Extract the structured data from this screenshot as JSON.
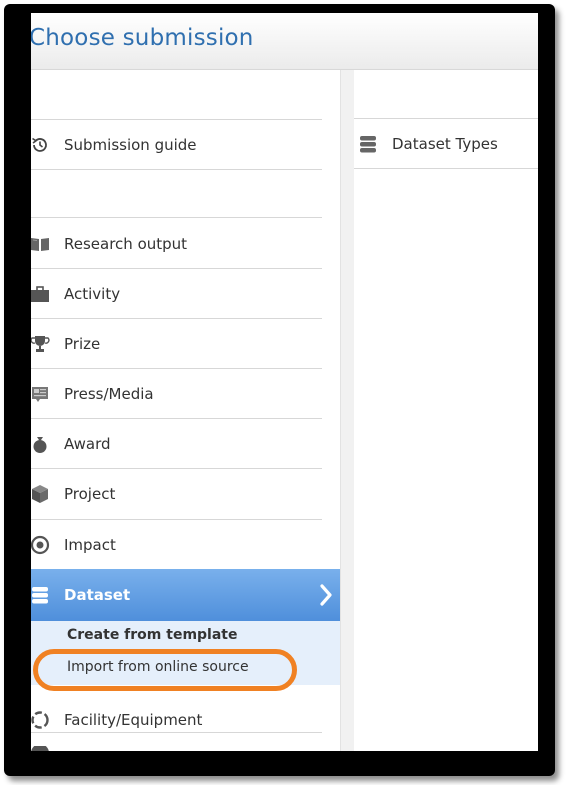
{
  "header": {
    "title": "Choose submission"
  },
  "menu": {
    "guide": {
      "label": "Submission guide",
      "icon": "history-icon"
    },
    "items": [
      {
        "label": "Research output",
        "icon": "book-icon"
      },
      {
        "label": "Activity",
        "icon": "briefcase-icon"
      },
      {
        "label": "Prize",
        "icon": "trophy-icon"
      },
      {
        "label": "Press/Media",
        "icon": "newspaper-icon"
      },
      {
        "label": "Award",
        "icon": "money-bag-icon"
      },
      {
        "label": "Project",
        "icon": "cube-icon"
      },
      {
        "label": "Impact",
        "icon": "target-icon"
      }
    ],
    "active": {
      "label": "Dataset",
      "icon": "database-icon"
    },
    "submenu": {
      "create": "Create from template",
      "import": "Import from online source"
    },
    "after": [
      {
        "label": "Facility/Equipment",
        "icon": "lifebuoy-icon"
      }
    ]
  },
  "right": {
    "item": {
      "label": "Dataset Types",
      "icon": "database-icon"
    }
  },
  "colors": {
    "accent": "#4f8fdb",
    "title": "#2f6faf",
    "highlight_ring": "#f08123",
    "submenu_bg": "#e5effb"
  }
}
